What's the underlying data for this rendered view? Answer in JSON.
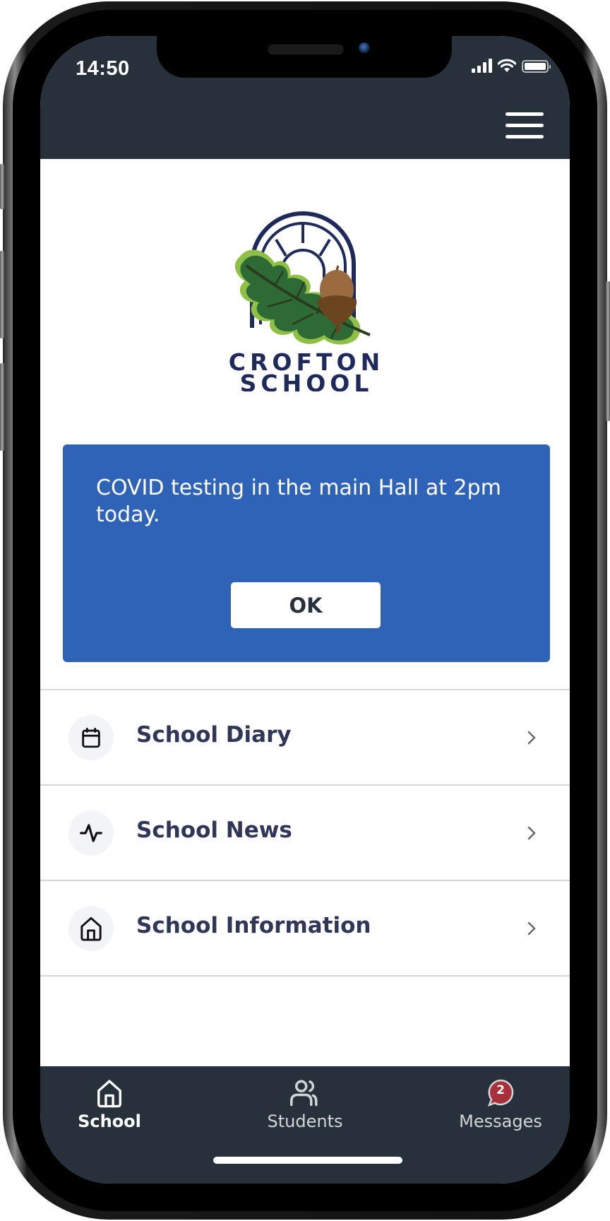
{
  "status_bar": {
    "time": "14:50",
    "icons": [
      "cellular-signal-icon",
      "wifi-icon",
      "battery-icon"
    ]
  },
  "header": {
    "menu_icon": "hamburger-menu-icon"
  },
  "logo": {
    "line1": "CROFTON",
    "line2": "SCHOOL"
  },
  "notice": {
    "message": "COVID testing in the main Hall at 2pm today.",
    "ok_label": "OK",
    "background_color": "#2f63b8"
  },
  "menu_list": [
    {
      "label": "School Diary",
      "icon": "calendar-icon"
    },
    {
      "label": "School News",
      "icon": "activity-pulse-icon"
    },
    {
      "label": "School Information",
      "icon": "home-icon"
    }
  ],
  "tabbar": {
    "tabs": [
      {
        "label": "School",
        "icon": "home-icon",
        "active": true
      },
      {
        "label": "Students",
        "icon": "users-icon",
        "active": false
      },
      {
        "label": "Messages",
        "icon": "chat-bubble-icon",
        "active": false,
        "badge": "2"
      }
    ],
    "badge_color": "#a8303a"
  },
  "colors": {
    "header_bg": "#27313b",
    "list_text": "#2f3658",
    "accent_blue": "#2f63b8"
  }
}
